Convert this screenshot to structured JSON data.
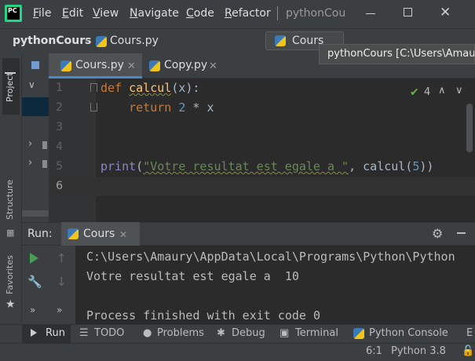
{
  "menu": [
    "File",
    "Edit",
    "View",
    "Navigate",
    "Code",
    "Refactor"
  ],
  "menu_mnemonic": [
    "F",
    "E",
    "V",
    "N",
    "C",
    "R"
  ],
  "window_title": "pythonCou",
  "logo_text": "PC",
  "breadcrumb": {
    "project": "pythonCours",
    "file": "Cours.py"
  },
  "run_config": "Cours",
  "tooltip": "pythonCours [C:\\Users\\Amaury",
  "left_tabs": {
    "project": "Project",
    "structure": "Structure",
    "favorites": "Favorites"
  },
  "editor_tabs": [
    {
      "label": "Cours.py",
      "active": true
    },
    {
      "label": "Copy.py",
      "active": false
    }
  ],
  "inspection": {
    "count": "4"
  },
  "line_numbers": [
    "1",
    "2",
    "3",
    "4",
    "5",
    "6"
  ],
  "code": {
    "l1_kw": "def",
    "l1_fn": "calcul",
    "l1_rest": "(x):",
    "l2_kw": "return",
    "l2_num": "2",
    "l2_rest": " * x",
    "l5_fn": "print",
    "l5_str": "\"Votre resultat est egale a \"",
    "l5_call": "calcul",
    "l5_num": "5"
  },
  "run_panel": {
    "label": "Run:",
    "tab": "Cours"
  },
  "console": [
    "C:\\Users\\Amaury\\AppData\\Local\\Programs\\Python\\Python",
    "Votre resultat est egale a  10",
    "",
    "Process finished with exit code 0"
  ],
  "bottom_tools": [
    "Run",
    "TODO",
    "Problems",
    "Debug",
    "Terminal",
    "Python Console",
    "E"
  ],
  "status": {
    "position": "6:1",
    "interpreter": "Python 3.8"
  },
  "colors": {
    "accent": "#4a88c7",
    "run_green": "#499c54",
    "keyword": "#cc7832",
    "function": "#ffc66d",
    "string": "#6a8759",
    "number": "#6897bb"
  }
}
